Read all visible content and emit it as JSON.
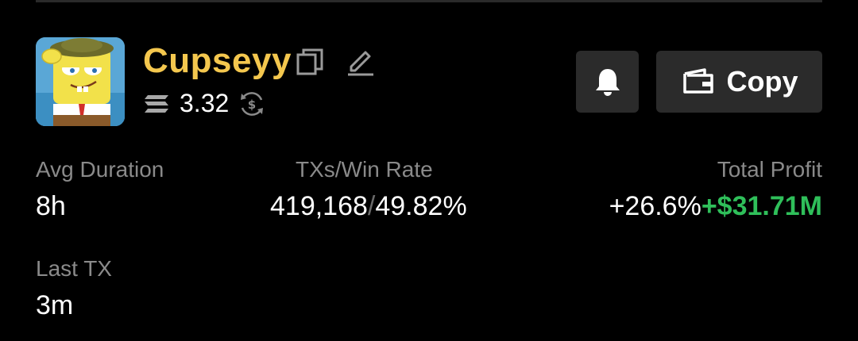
{
  "profile": {
    "name": "Cupseyy",
    "balance": "3.32",
    "avatar_description_icon": "spongebob-avatar"
  },
  "actions": {
    "copy_label": "Copy"
  },
  "stats": {
    "avg_duration": {
      "label": "Avg Duration",
      "value": "8h"
    },
    "txs_win_rate": {
      "label": "TXs/Win Rate",
      "txs": "419,168",
      "separator": "/",
      "win_rate": "49.82%"
    },
    "total_profit": {
      "label": "Total Profit",
      "percent": "+26.6%",
      "usd": "+$31.71M"
    },
    "last_tx": {
      "label": "Last TX",
      "value": "3m"
    }
  },
  "colors": {
    "name": "#f4c74e",
    "profit_positive": "#2fbf5a",
    "button_bg": "#2b2b2b",
    "label_gray": "#8a8a8a"
  }
}
